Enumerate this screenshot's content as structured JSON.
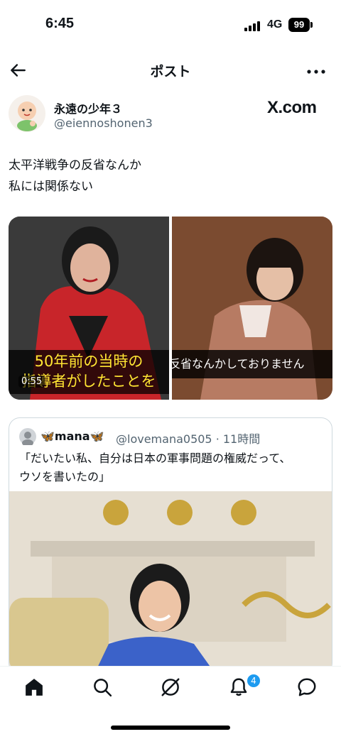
{
  "status_bar": {
    "time": "6:45",
    "network": "4G",
    "battery": "99"
  },
  "header": {
    "title": "ポスト"
  },
  "post": {
    "display_name": "永遠の少年３",
    "handle": "@eiennoshonen3",
    "site_label": "X.com",
    "text": "太平洋戦争の反省なんか\n私には関係ない",
    "media": {
      "left_caption": "50年前の当時の\n指導者がしたことを",
      "right_caption": "反省なんかしておりません",
      "duration": "0:55"
    }
  },
  "quoted_post": {
    "display_name": "🦋mana🦋",
    "handle_time": "@lovemana0505 · 11時間",
    "text": "「だいたい私、自分は日本の軍事問題の権威だって、\nウソを書いたの」"
  },
  "bottom_nav": {
    "items": [
      "home-icon",
      "search-icon",
      "grok-icon",
      "notifications-icon",
      "messages-icon"
    ],
    "notification_badge": "4"
  },
  "colors": {
    "accent": "#1d9bf0",
    "text": "#0f1419",
    "secondary": "#536471",
    "caption_yellow": "#ffe533"
  }
}
